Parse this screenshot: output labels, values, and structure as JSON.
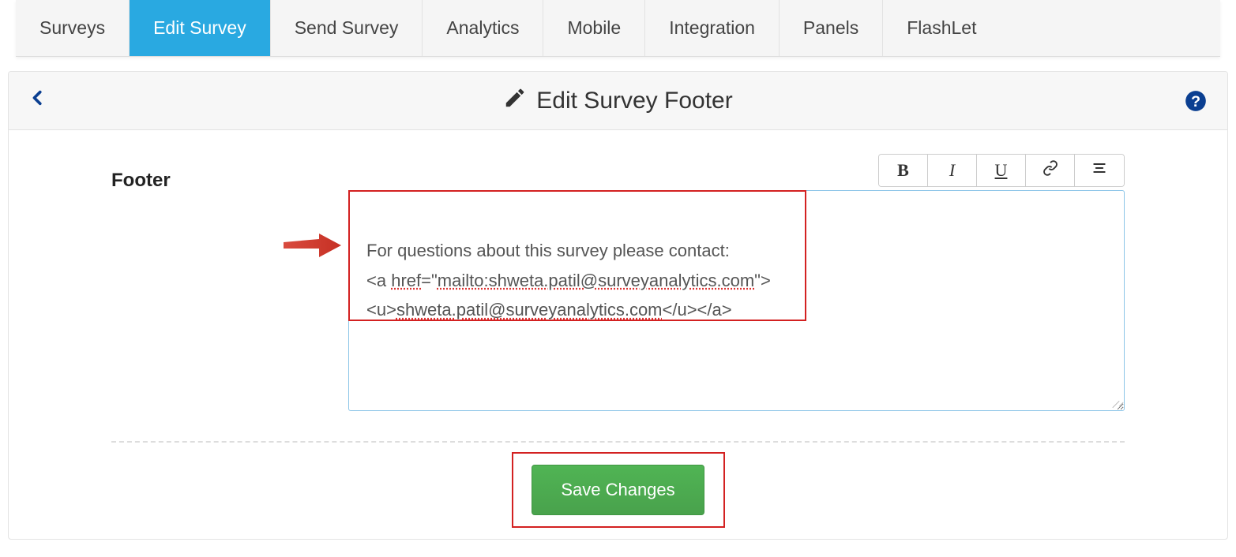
{
  "nav": {
    "items": [
      {
        "label": "Surveys",
        "active": false
      },
      {
        "label": "Edit Survey",
        "active": true
      },
      {
        "label": "Send Survey",
        "active": false
      },
      {
        "label": "Analytics",
        "active": false
      },
      {
        "label": "Mobile",
        "active": false
      },
      {
        "label": "Integration",
        "active": false
      },
      {
        "label": "Panels",
        "active": false
      },
      {
        "label": "FlashLet",
        "active": false
      }
    ]
  },
  "panel": {
    "title": "Edit Survey Footer"
  },
  "form": {
    "footer_label": "Footer",
    "toolbar": {
      "bold": "B",
      "italic": "I",
      "underline": "U"
    },
    "editor_line1": "For questions about this survey please contact:",
    "editor_line2_prefix": "<a ",
    "editor_line2_href": "href",
    "editor_line2_mid": "=\"",
    "editor_line2_url": "mailto:shweta.patil@surveyanalytics.com",
    "editor_line2_suffix": "\">",
    "editor_line3_prefix": "<u>",
    "editor_line3_email": "shweta.patil@surveyanalytics.com",
    "editor_line3_suffix": "</u></a>"
  },
  "actions": {
    "save": "Save Changes"
  }
}
